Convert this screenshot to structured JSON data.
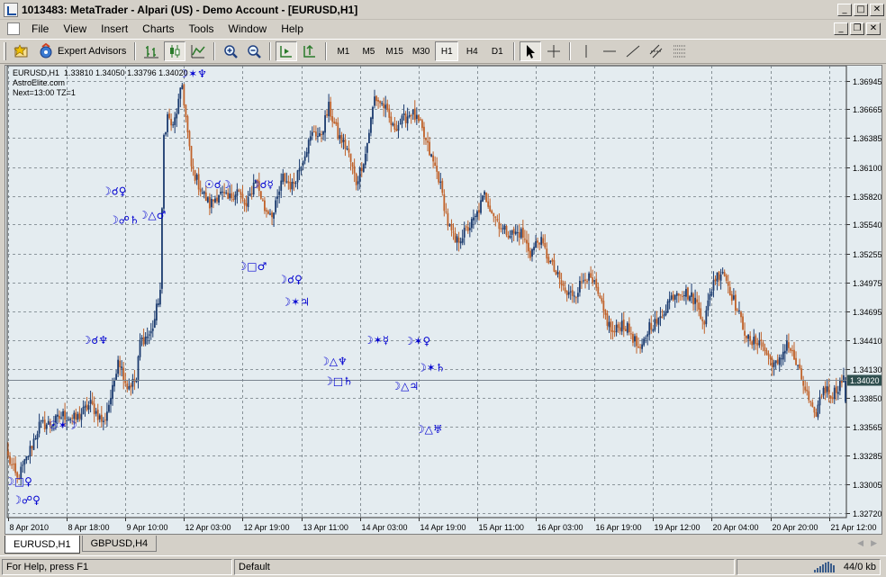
{
  "window": {
    "title": "1013483: MetaTrader - Alpari (US) - Demo Account - [EURUSD,H1]",
    "minimize": "_",
    "maximize": "□",
    "close": "✕",
    "restore": "❐"
  },
  "menu": [
    "File",
    "View",
    "Insert",
    "Charts",
    "Tools",
    "Window",
    "Help"
  ],
  "toolbar": {
    "expert_advisors_label": "Expert Advisors",
    "timeframes": [
      "M1",
      "M5",
      "M15",
      "M30",
      "H1",
      "H4",
      "D1"
    ],
    "active_timeframe": "H1"
  },
  "chart": {
    "info_line1": "EURUSD,H1  1.33810 1.34050 1.33796 1.34020",
    "info_line2": "AstroElite.com",
    "info_line3": "Next=13:00 TZ=1",
    "current_price": "1.34020",
    "colors": {
      "background": "#e4ecf0",
      "bull": "#1b3b6f",
      "bear": "#c0622a",
      "grid": "#6f7a80",
      "symbol": "#0000d0",
      "price_line": "#7a8590"
    }
  },
  "chart_data": {
    "type": "candlestick",
    "symbol": "EURUSD",
    "timeframe": "H1",
    "y_ticks": [
      "1.36945",
      "1.36665",
      "1.36385",
      "1.36100",
      "1.35820",
      "1.35540",
      "1.35255",
      "1.34975",
      "1.34695",
      "1.34410",
      "1.34130",
      "1.33850",
      "1.33565",
      "1.33285",
      "1.33005",
      "1.32720"
    ],
    "y_tick_values": [
      1.36945,
      1.36665,
      1.36385,
      1.361,
      1.3582,
      1.3554,
      1.35255,
      1.34975,
      1.34695,
      1.3441,
      1.3413,
      1.3385,
      1.33565,
      1.33285,
      1.33005,
      1.3272
    ],
    "x_ticks": [
      "8 Apr 2010",
      "8 Apr 18:00",
      "9 Apr 10:00",
      "12 Apr 03:00",
      "12 Apr 19:00",
      "13 Apr 11:00",
      "14 Apr 03:00",
      "14 Apr 19:00",
      "15 Apr 11:00",
      "16 Apr 03:00",
      "16 Apr 19:00",
      "19 Apr 12:00",
      "20 Apr 04:00",
      "20 Apr 20:00",
      "21 Apr 12:00"
    ],
    "ylim": [
      1.3268,
      1.3709
    ],
    "close_path": [
      [
        1.3327,
        0
      ],
      [
        1.3305,
        5
      ],
      [
        1.3325,
        10
      ],
      [
        1.3358,
        17
      ],
      [
        1.336,
        24
      ],
      [
        1.3368,
        30
      ],
      [
        1.3364,
        37
      ],
      [
        1.3379,
        45
      ],
      [
        1.336,
        52
      ],
      [
        1.3392,
        57
      ],
      [
        1.3425,
        60
      ],
      [
        1.3396,
        65
      ],
      [
        1.3402,
        70
      ],
      [
        1.344,
        72
      ],
      [
        1.3448,
        78
      ],
      [
        1.3462,
        80
      ],
      [
        1.349,
        83
      ],
      [
        1.364,
        85
      ],
      [
        1.366,
        87
      ],
      [
        1.3648,
        90
      ],
      [
        1.369,
        95
      ],
      [
        1.361,
        100
      ],
      [
        1.3589,
        105
      ],
      [
        1.3573,
        110
      ],
      [
        1.3585,
        115
      ],
      [
        1.3578,
        120
      ],
      [
        1.3588,
        125
      ],
      [
        1.357,
        130
      ],
      [
        1.36,
        135
      ],
      [
        1.3569,
        140
      ],
      [
        1.3565,
        145
      ],
      [
        1.36,
        150
      ],
      [
        1.3591,
        155
      ],
      [
        1.3625,
        162
      ],
      [
        1.3646,
        167
      ],
      [
        1.3638,
        170
      ],
      [
        1.3668,
        175
      ],
      [
        1.3641,
        180
      ],
      [
        1.3628,
        185
      ],
      [
        1.3595,
        190
      ],
      [
        1.3623,
        195
      ],
      [
        1.3678,
        200
      ],
      [
        1.367,
        205
      ],
      [
        1.3648,
        210
      ],
      [
        1.3655,
        215
      ],
      [
        1.3664,
        220
      ],
      [
        1.365,
        225
      ],
      [
        1.3624,
        230
      ],
      [
        1.36,
        235
      ],
      [
        1.3555,
        240
      ],
      [
        1.3536,
        244
      ],
      [
        1.3548,
        250
      ],
      [
        1.356,
        255
      ],
      [
        1.3583,
        260
      ],
      [
        1.3564,
        265
      ],
      [
        1.3549,
        270
      ],
      [
        1.3545,
        275
      ],
      [
        1.3546,
        280
      ],
      [
        1.3526,
        285
      ],
      [
        1.354,
        290
      ],
      [
        1.352,
        295
      ],
      [
        1.3502,
        300
      ],
      [
        1.3485,
        305
      ],
      [
        1.3488,
        310
      ],
      [
        1.3505,
        315
      ],
      [
        1.3494,
        320
      ],
      [
        1.3468,
        325
      ],
      [
        1.3447,
        330
      ],
      [
        1.3458,
        335
      ],
      [
        1.3448,
        340
      ],
      [
        1.3428,
        345
      ],
      [
        1.3456,
        350
      ],
      [
        1.3459,
        355
      ],
      [
        1.3478,
        360
      ],
      [
        1.349,
        365
      ],
      [
        1.3487,
        370
      ],
      [
        1.348,
        375
      ],
      [
        1.346,
        380
      ],
      [
        1.35,
        385
      ],
      [
        1.351,
        390
      ],
      [
        1.3485,
        395
      ],
      [
        1.346,
        400
      ],
      [
        1.3437,
        405
      ],
      [
        1.3442,
        410
      ],
      [
        1.3424,
        415
      ],
      [
        1.3415,
        420
      ],
      [
        1.344,
        425
      ],
      [
        1.3418,
        430
      ],
      [
        1.3393,
        435
      ],
      [
        1.3365,
        440
      ],
      [
        1.3395,
        445
      ],
      [
        1.3388,
        450
      ],
      [
        1.3402,
        455
      ]
    ],
    "annotations": [
      {
        "text": "☽✶♆",
        "i": 96,
        "price": 1.3703
      },
      {
        "text": "☽☌♀",
        "i": 54,
        "price": 1.3588
      },
      {
        "text": "☽☍♄",
        "i": 58,
        "price": 1.356
      },
      {
        "text": "☽△♂",
        "i": 74,
        "price": 1.3565
      },
      {
        "text": "☉☌☽",
        "i": 110,
        "price": 1.3595
      },
      {
        "text": "☽☌☿",
        "i": 135,
        "price": 1.3595
      },
      {
        "text": "☽□♂",
        "i": 128,
        "price": 1.3515
      },
      {
        "text": "☽☌♀",
        "i": 150,
        "price": 1.3502
      },
      {
        "text": "☽✶♃",
        "i": 152,
        "price": 1.348
      },
      {
        "text": "☽☌♆",
        "i": 43,
        "price": 1.3443
      },
      {
        "text": "☉✶☽",
        "i": 25,
        "price": 1.336
      },
      {
        "text": "☽□♀",
        "i": 1,
        "price": 1.3305
      },
      {
        "text": "☽☍♀",
        "i": 5,
        "price": 1.3287
      },
      {
        "text": "☽△♆",
        "i": 173,
        "price": 1.3422
      },
      {
        "text": "☽□♄",
        "i": 175,
        "price": 1.3403
      },
      {
        "text": "☽✶☿",
        "i": 197,
        "price": 1.3443
      },
      {
        "text": "☽✶♀",
        "i": 219,
        "price": 1.3442
      },
      {
        "text": "☽△♃",
        "i": 212,
        "price": 1.3398
      },
      {
        "text": "☽✶♄",
        "i": 226,
        "price": 1.3416
      },
      {
        "text": "☽△♅",
        "i": 225,
        "price": 1.3356
      }
    ]
  },
  "tabs": [
    "EURUSD,H1",
    "GBPUSD,H4"
  ],
  "active_tab": "EURUSD,H1",
  "status": {
    "help": "For Help, press F1",
    "profile": "Default",
    "traffic": "44/0 kb"
  }
}
